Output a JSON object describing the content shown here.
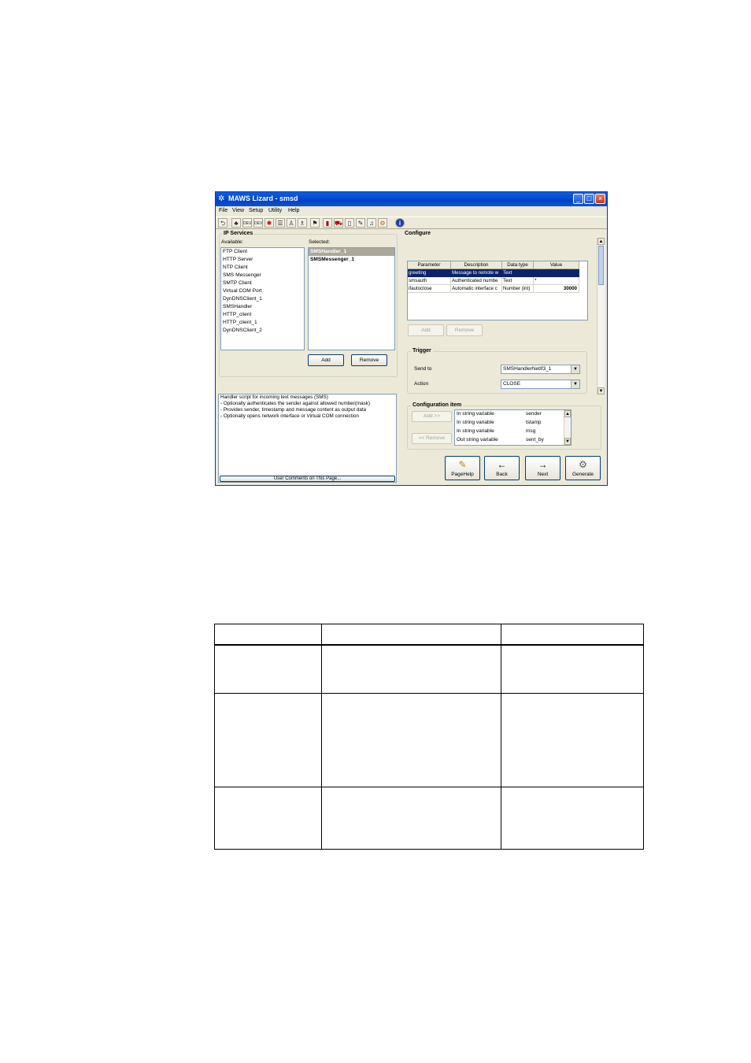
{
  "window": {
    "title": "MAWS Lizard - smsd",
    "controls": [
      "_",
      "□",
      "×"
    ]
  },
  "menu": [
    "File",
    "View",
    "Setup",
    "Utility",
    "Help"
  ],
  "toolbar_icons": [
    "back-arrow-icon",
    "network-icon",
    "dev-icon",
    "dev2-icon",
    "star-icon",
    "list-icon",
    "person-icon",
    "person-run-icon",
    "flag-icon",
    "device-icon",
    "car-icon",
    "document-icon",
    "pen-icon",
    "bell-icon",
    "gear-icon",
    "info-icon"
  ],
  "ip_services": {
    "title": "IP Services",
    "available_label": "Available:",
    "selected_label": "Selected:",
    "available": [
      "FTP Client",
      "HTTP Server",
      "NTP Client",
      "SMS Messenger",
      "SMTP Client",
      "Virtual COM Port",
      "DynDNSClient_1",
      "SMSHandler",
      "HTTP_client",
      "HTTP_client_1",
      "DynDNSClient_2"
    ],
    "selected": [
      "SMSHandler_1",
      "SMSMessenger_1"
    ],
    "add": "Add",
    "remove": "Remove"
  },
  "description": [
    "Handler script for incoming text messages (SMS)",
    "- Optionally authenticates the sender against allowed number(mask)",
    "- Provides sender, timestamp and message content as output data",
    "- Optionally opens network interface or Virtual COM connection"
  ],
  "user_comments": "User Comments on This Page...",
  "configure": {
    "title": "Configure",
    "columns": [
      "Parameter",
      "Description",
      "Data type",
      "Value"
    ],
    "rows": [
      [
        "greeting",
        "Message to remote w",
        "Text",
        ""
      ],
      [
        "smsauth",
        "Authenticated numbe",
        "Text",
        "*"
      ],
      [
        "ifautoclose",
        "Automatic interface c",
        "Number (int)",
        "30000"
      ]
    ],
    "add": "Add",
    "remove": "Remove",
    "trigger": {
      "title": "Trigger",
      "send_to_label": "Send to",
      "send_to": "SMSHandlerNetIf3_1",
      "action_label": "Action",
      "action": "CLOSE"
    }
  },
  "config_item": {
    "title": "Configuration item",
    "add": "Add >>",
    "remove": "<< Remove",
    "items": [
      [
        "In string variable",
        "sender"
      ],
      [
        "In string variable",
        "tstamp"
      ],
      [
        "In string variable",
        "msg"
      ],
      [
        "Out string variable",
        "sent_by"
      ]
    ]
  },
  "nav": {
    "pagehelp": "PageHelp",
    "back": "Back",
    "next": "Next",
    "generate": "Generate"
  }
}
